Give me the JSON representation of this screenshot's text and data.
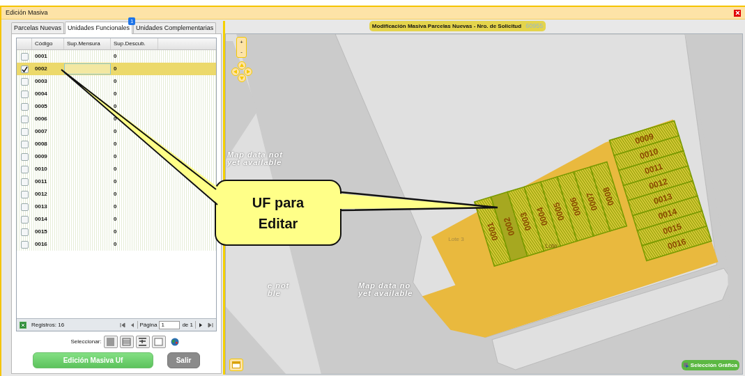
{
  "window": {
    "title": "Edición Masiva"
  },
  "tabs": [
    {
      "label": "Parcelas Nuevas",
      "selected": false
    },
    {
      "label": "Unidades Funcionales",
      "selected": true,
      "badge": "1"
    },
    {
      "label": "Unidades Complementarias",
      "selected": false
    }
  ],
  "grid": {
    "columns": [
      "Código",
      "Sup.Mensura",
      "Sup.Descub."
    ],
    "rows": [
      {
        "code": "0001",
        "sup_descub": "0",
        "checked": false,
        "selected": false
      },
      {
        "code": "0002",
        "sup_descub": "0",
        "checked": true,
        "selected": true
      },
      {
        "code": "0003",
        "sup_descub": "0",
        "checked": false,
        "selected": false
      },
      {
        "code": "0004",
        "sup_descub": "0",
        "checked": false,
        "selected": false
      },
      {
        "code": "0005",
        "sup_descub": "0",
        "checked": false,
        "selected": false
      },
      {
        "code": "0006",
        "sup_descub": "0",
        "checked": false,
        "selected": false
      },
      {
        "code": "0007",
        "sup_descub": "0",
        "checked": false,
        "selected": false
      },
      {
        "code": "0008",
        "sup_descub": "0",
        "checked": false,
        "selected": false
      },
      {
        "code": "0009",
        "sup_descub": "0",
        "checked": false,
        "selected": false
      },
      {
        "code": "0010",
        "sup_descub": "0",
        "checked": false,
        "selected": false
      },
      {
        "code": "0011",
        "sup_descub": "0",
        "checked": false,
        "selected": false
      },
      {
        "code": "0012",
        "sup_descub": "0",
        "checked": false,
        "selected": false
      },
      {
        "code": "0013",
        "sup_descub": "0",
        "checked": false,
        "selected": false
      },
      {
        "code": "0014",
        "sup_descub": "0",
        "checked": false,
        "selected": false
      },
      {
        "code": "0015",
        "sup_descub": "0",
        "checked": false,
        "selected": false
      },
      {
        "code": "0016",
        "sup_descub": "0",
        "checked": false,
        "selected": false
      }
    ]
  },
  "pager": {
    "records": "Registros: 16",
    "page_label": "Página",
    "page": "1",
    "of": "de 1"
  },
  "select_bar": {
    "label": "Seleccionar:"
  },
  "buttons": [
    {
      "label": "Edición Masiva Uf",
      "kind": "primary"
    },
    {
      "label": "Salir",
      "kind": "secondary"
    }
  ],
  "map": {
    "header": "Modificación Masiva Parcelas Nuevas - Nro. de Solicitud",
    "request_number": "60955",
    "zoom_in": "+",
    "zoom_out": "-",
    "notices": [
      {
        "lines": [
          "Map data not",
          "yet available"
        ]
      },
      {
        "lines": [
          "e not",
          "ble"
        ]
      },
      {
        "lines": [
          "Map data no",
          "yet available"
        ]
      }
    ],
    "lots": [
      "Lote 3",
      "Lote"
    ],
    "parcels": [
      {
        "label": "0001",
        "selected": false
      },
      {
        "label": "0002",
        "selected": true
      },
      {
        "label": "0003",
        "selected": false
      },
      {
        "label": "0004",
        "selected": false
      },
      {
        "label": "0005",
        "selected": false
      },
      {
        "label": "0006",
        "selected": false
      },
      {
        "label": "0007",
        "selected": false
      },
      {
        "label": "0008",
        "selected": false
      },
      {
        "label": "0009",
        "selected": false
      },
      {
        "label": "0010",
        "selected": false
      },
      {
        "label": "0011",
        "selected": false
      },
      {
        "label": "0012",
        "selected": false
      },
      {
        "label": "0013",
        "selected": false
      },
      {
        "label": "0014",
        "selected": false
      },
      {
        "label": "0015",
        "selected": false
      },
      {
        "label": "0016",
        "selected": false
      }
    ],
    "graphic_selection": "Selección Gráfica"
  },
  "callout": {
    "text": "UF para Editar"
  }
}
